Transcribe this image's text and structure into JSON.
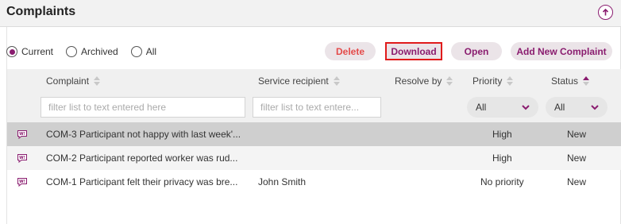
{
  "header": {
    "title": "Complaints"
  },
  "filters": {
    "radios": [
      {
        "label": "Current",
        "checked": true
      },
      {
        "label": "Archived",
        "checked": false
      },
      {
        "label": "All",
        "checked": false
      }
    ]
  },
  "toolbar": {
    "delete_label": "Delete",
    "download_label": "Download",
    "open_label": "Open",
    "add_label": "Add New Complaint"
  },
  "columns": {
    "complaint": "Complaint",
    "service_recipient": "Service recipient",
    "resolve_by": "Resolve by",
    "priority": "Priority",
    "status": "Status"
  },
  "column_filters": {
    "complaint_placeholder": "filter list to text entered here",
    "service_recipient_placeholder": "filter list to text entere...",
    "priority_value": "All",
    "status_value": "All"
  },
  "rows": [
    {
      "complaint": "COM-3 Participant not happy with last week'...",
      "service_recipient": "",
      "resolve_by": "",
      "priority": "High",
      "status": "New"
    },
    {
      "complaint": "COM-2 Participant reported worker was rud...",
      "service_recipient": "",
      "resolve_by": "",
      "priority": "High",
      "status": "New"
    },
    {
      "complaint": "COM-1 Participant felt their privacy was bre...",
      "service_recipient": "John Smith",
      "resolve_by": "",
      "priority": "No priority",
      "status": "New"
    }
  ],
  "colors": {
    "accent": "#8a1c6f",
    "delete": "#e44a4a",
    "highlight_border": "#e01b1b"
  }
}
